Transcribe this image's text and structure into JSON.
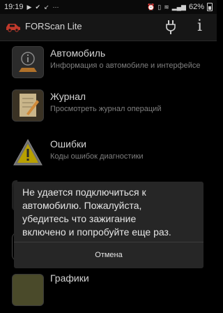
{
  "status_bar": {
    "time": "19:19",
    "battery": "62%",
    "icons": [
      "video-icon",
      "check-icon",
      "missed-call-icon",
      "more-icon",
      "alarm-icon",
      "vibrate-icon",
      "wifi-icon",
      "signal-icon",
      "battery-icon"
    ]
  },
  "app": {
    "title": "FORScan Lite",
    "actions": [
      "plug-icon",
      "info-icon"
    ],
    "brand_color": "#c0392b"
  },
  "menu": {
    "items": [
      {
        "title": "Автомобиль",
        "subtitle": "Информация о автомобиле и интерфейсе",
        "icon": "car-info-icon"
      },
      {
        "title": "Журнал",
        "subtitle": "Просмотреть журнал операций",
        "icon": "notebook-icon"
      },
      {
        "title": "Ошибки",
        "subtitle": "Коды ошибок диагностики",
        "icon": "warning-icon"
      },
      {
        "title": "Графики",
        "subtitle": "",
        "icon": "graph-icon"
      }
    ]
  },
  "dialog": {
    "message": "Не удается подключиться к\nавтомобилю. Пожалуйста,\n убедитесь что зажигание\nвключено и попробуйте еще раз.",
    "button": "Отмена"
  }
}
